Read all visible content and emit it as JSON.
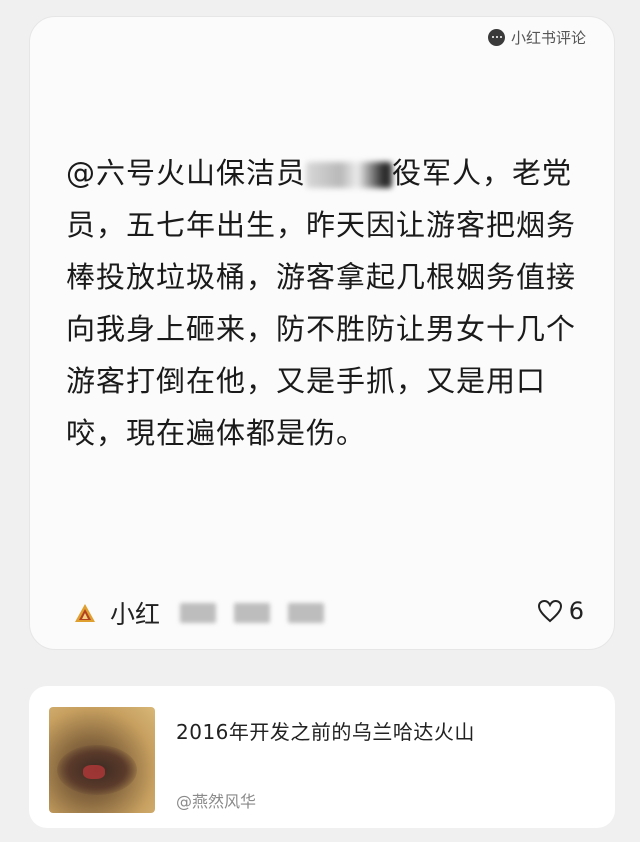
{
  "comment": {
    "source_label": "小红书评论",
    "text_before": "@六号火山保洁员",
    "text_after": "役军人，老党员，五七年出生，昨天因让游客把烟务棒投放垃圾桶，游客拿起几根姻务值接向我身上砸来，防不胜防让男女十几个游客打倒在他，又是手抓，又是用口咬，現在遍体都是伤。",
    "author_name": "小红",
    "like_count": "6",
    "icons": {
      "source": "chat-bubble-icon",
      "avatar": "mountain-icon",
      "like": "heart-icon"
    }
  },
  "link_card": {
    "title": "2016年开发之前的乌兰哈达火山",
    "source": "@燕然风华",
    "icons": {
      "thumbnail": "volcano-photo"
    }
  },
  "colors": {
    "background": "#f0f0f1",
    "card": "#fbfbfb",
    "text": "#1a1a1a",
    "muted": "#8a8a8a"
  }
}
